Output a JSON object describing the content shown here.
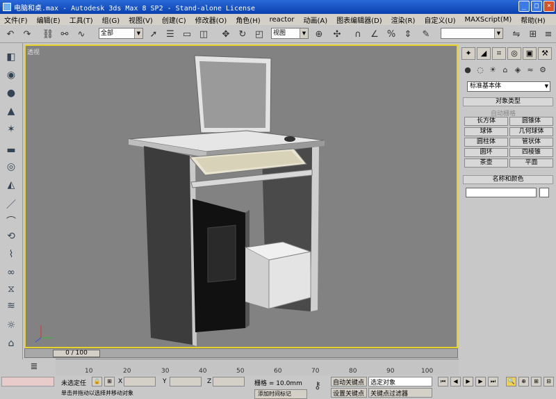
{
  "window": {
    "title": "电脑和桌.max - Autodesk 3ds Max 8 SP2  - Stand-alone License"
  },
  "menu": [
    "文件(F)",
    "编辑(E)",
    "工具(T)",
    "组(G)",
    "视图(V)",
    "创建(C)",
    "修改器(O)",
    "角色(H)",
    "reactor",
    "动画(A)",
    "图表编辑器(D)",
    "渲染(R)",
    "自定义(U)",
    "MAXScript(M)",
    "帮助(H)"
  ],
  "toolbar": {
    "selection_filter": "全部",
    "reference_coord": "视图",
    "named_selection": ""
  },
  "viewport": {
    "label": "透视"
  },
  "command_panel": {
    "category": "标准基本体",
    "object_type_title": "对象类型",
    "autogrid_label": "自动栅格",
    "objects": [
      "长方体",
      "圆锥体",
      "球体",
      "几何球体",
      "圆柱体",
      "管状体",
      "圆环",
      "四棱锥",
      "茶壶",
      "平面"
    ],
    "name_color_title": "名称和颜色"
  },
  "timeline": {
    "frame": "0 / 100",
    "ticks": [
      "10",
      "20",
      "30",
      "40",
      "50",
      "60",
      "70",
      "80",
      "90",
      "100"
    ]
  },
  "status": {
    "selection": "未选定任",
    "x_label": "X",
    "y_label": "Y",
    "z_label": "Z",
    "grid": "栅格 = 10.0mm",
    "autokey": "自动关键点",
    "selected": "选定对象",
    "setkey": "设置关键点",
    "key_filter": "关键点过滤器",
    "prompt": "单击并拖动以选择并移动对象",
    "add_time": "添加时间标记"
  },
  "colors": {
    "viewport_bg": "#828282",
    "active_border": "#e8d32c",
    "title_blue": "#0a3fae"
  }
}
